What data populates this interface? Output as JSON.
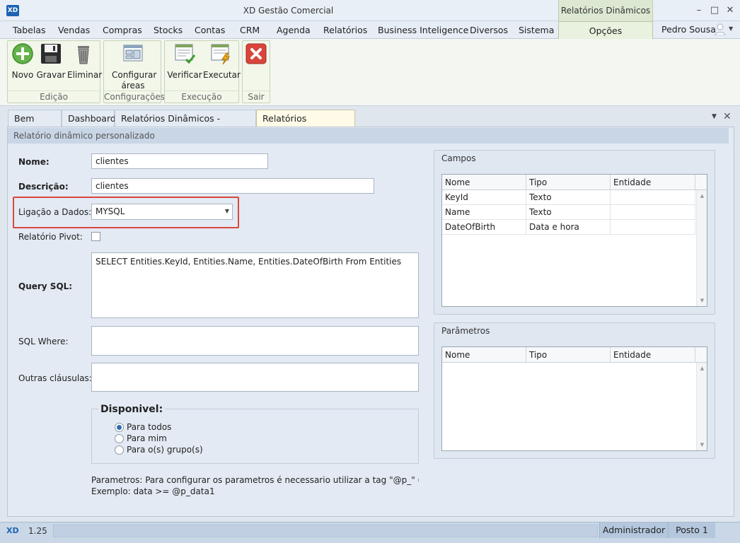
{
  "window": {
    "title": "XD Gestão Comercial",
    "logo": "XD",
    "context_tab_title": "Relatórios Dinâmicos",
    "controls": {
      "minimize": "–",
      "maximize": "□",
      "close": "✕"
    }
  },
  "menu": {
    "items": [
      "Tabelas",
      "Vendas",
      "Compras",
      "Stocks",
      "Contas",
      "CRM",
      "Agenda",
      "Relatórios",
      "Business Inteligence",
      "Diversos",
      "Sistema"
    ],
    "active_tab": "Opções",
    "user": "Pedro Sousa"
  },
  "ribbon": {
    "groups": [
      {
        "label": "Edição",
        "buttons": [
          {
            "label": "Novo",
            "icon": "add-circle-icon"
          },
          {
            "label": "Gravar",
            "icon": "save-disk-icon"
          },
          {
            "label": "Eliminar",
            "icon": "trash-bin-icon"
          }
        ]
      },
      {
        "label": "Configurações",
        "buttons": [
          {
            "label": "Configurar áreas",
            "icon": "layout-config-icon"
          }
        ]
      },
      {
        "label": "Execução",
        "buttons": [
          {
            "label": "Verificar",
            "icon": "check-document-icon"
          },
          {
            "label": "Executar",
            "icon": "execute-lightning-icon"
          }
        ]
      },
      {
        "label": "Sair",
        "buttons": [
          {
            "label": "",
            "icon": "exit-x-icon"
          }
        ]
      }
    ]
  },
  "doc_tabs": [
    {
      "label": "Bem vindo",
      "closable": false
    },
    {
      "label": "Dashboard",
      "closable": false
    },
    {
      "label": "Relatórios Dinâmicos - Listagem",
      "closable": true
    },
    {
      "label": "Relatórios Dinâmicos",
      "closable": true,
      "active": true
    }
  ],
  "form": {
    "header": "Relatório dinâmico personalizado",
    "nome_label": "Nome:",
    "nome_value": "clientes",
    "descricao_label": "Descrição:",
    "descricao_value": "clientes",
    "ligacao_label": "Ligação a Dados:",
    "ligacao_value": "MYSQL",
    "pivot_label": "Relatório Pivot:",
    "pivot_checked": false,
    "query_label": "Query SQL:",
    "query_value": "SELECT Entities.KeyId, Entities.Name, Entities.DateOfBirth From Entities",
    "where_label": "SQL Where:",
    "where_value": "",
    "outras_label": "Outras cláusulas:",
    "outras_value": "",
    "disponivel": {
      "title": "Disponivel:",
      "options": [
        "Para todos",
        "Para mim",
        "Para o(s) grupo(s)"
      ],
      "selected": "Para todos"
    },
    "hint_line1": "Parametros: Para configurar os parametros é necessario utilizar a tag \"@p_\" (Sem aspas)",
    "hint_line2": "Exemplo: data >= @p_data1"
  },
  "campos": {
    "title": "Campos",
    "columns": [
      "Nome",
      "Tipo",
      "Entidade"
    ],
    "rows": [
      [
        "KeyId",
        "Texto",
        ""
      ],
      [
        "Name",
        "Texto",
        ""
      ],
      [
        "DateOfBirth",
        "Data e hora",
        ""
      ]
    ]
  },
  "parametros": {
    "title": "Parâmetros",
    "columns": [
      "Nome",
      "Tipo",
      "Entidade"
    ],
    "rows": []
  },
  "status": {
    "logo": "XD",
    "version": "1.25",
    "user": "Administrador",
    "station": "Posto 1"
  },
  "colors": {
    "highlight": "#d9473f",
    "accent": "#1d63b3",
    "context_tab": "#e8f2de"
  }
}
